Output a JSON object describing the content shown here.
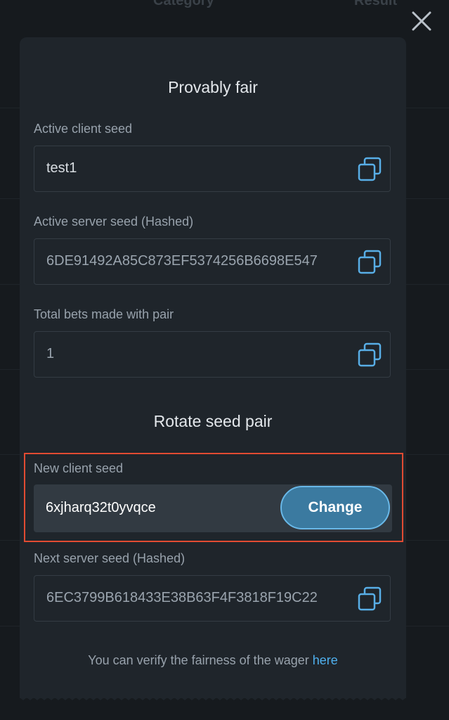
{
  "background": {
    "header": {
      "category_label": "Category",
      "result_label": "Result"
    }
  },
  "modal": {
    "title": "Provably fair",
    "active_client_seed": {
      "label": "Active client seed",
      "value": "test1",
      "copy_icon": "copy-icon"
    },
    "active_server_seed": {
      "label": "Active server seed (Hashed)",
      "value": "6DE91492A85C873EF5374256B6698E547",
      "copy_icon": "copy-icon"
    },
    "total_bets": {
      "label": "Total bets made with pair",
      "value": "1",
      "copy_icon": "copy-icon"
    },
    "rotate_title": "Rotate seed pair",
    "new_client_seed": {
      "label": "New client seed",
      "value": "6xjharq32t0yvqce",
      "button_label": "Change"
    },
    "next_server_seed": {
      "label": "Next server seed (Hashed)",
      "value": "6EC3799B618433E38B63F4F3818F19C22",
      "copy_icon": "copy-icon"
    },
    "footer": {
      "text": "You can verify the fairness of the wager ",
      "link_label": "here"
    }
  },
  "colors": {
    "modal_bg": "#1f252b",
    "accent": "#4fb0ee",
    "button_bg": "#3b7aa0",
    "highlight_border": "#e14b32"
  }
}
